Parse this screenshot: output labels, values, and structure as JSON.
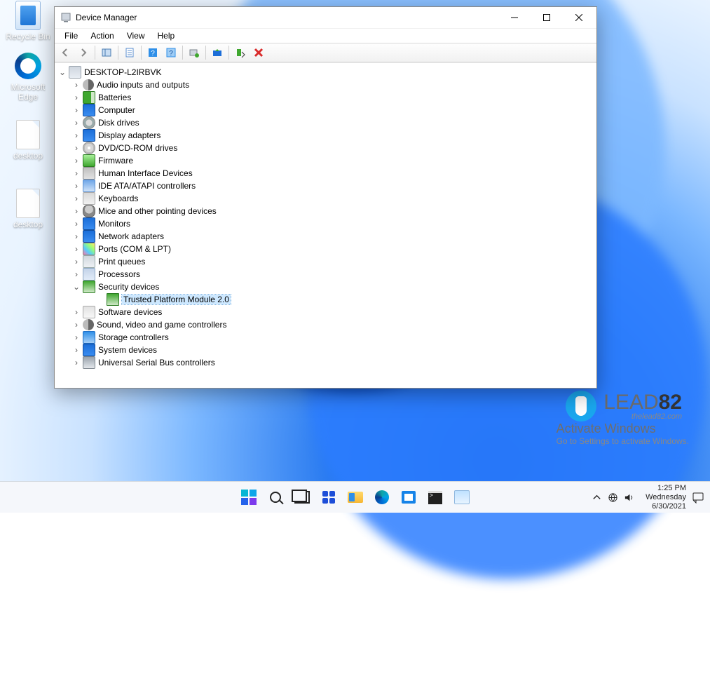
{
  "desktop": {
    "icons": [
      {
        "name": "recycle-bin",
        "label": "Recycle Bin"
      },
      {
        "name": "edge",
        "label": "Microsoft Edge"
      },
      {
        "name": "file1",
        "label": "desktop"
      },
      {
        "name": "file2",
        "label": "desktop"
      }
    ]
  },
  "watermark": {
    "line1": "Activate Windows",
    "line2": "Go to Settings to activate Windows."
  },
  "lead82": {
    "brand_lead": "LEAD",
    "brand_num": "82",
    "site": "thelead82.com"
  },
  "taskbar": {
    "buttons": [
      {
        "name": "start"
      },
      {
        "name": "search"
      },
      {
        "name": "task-view"
      },
      {
        "name": "widgets"
      },
      {
        "name": "file-explorer"
      },
      {
        "name": "edge"
      },
      {
        "name": "store"
      },
      {
        "name": "cmd"
      },
      {
        "name": "devmgmt"
      }
    ],
    "clock": {
      "time": "1:25 PM",
      "day": "Wednesday",
      "date": "6/30/2021"
    }
  },
  "devmgr": {
    "title": "Device Manager",
    "menu": [
      "File",
      "Action",
      "View",
      "Help"
    ],
    "toolbar": [
      {
        "name": "back-icon"
      },
      {
        "name": "forward-icon"
      },
      {
        "sep": true
      },
      {
        "name": "show-hidden-icon"
      },
      {
        "sep": true
      },
      {
        "name": "properties-icon"
      },
      {
        "sep": true
      },
      {
        "name": "help-icon"
      },
      {
        "name": "help-topics-icon"
      },
      {
        "sep": true
      },
      {
        "name": "scan-hardware-icon"
      },
      {
        "sep": true
      },
      {
        "name": "update-driver-icon"
      },
      {
        "sep": true
      },
      {
        "name": "uninstall-icon"
      },
      {
        "name": "disable-icon"
      }
    ],
    "root": "DESKTOP-L2IRBVK",
    "categories": [
      {
        "name": "Audio inputs and outputs",
        "icon": "i-aud"
      },
      {
        "name": "Batteries",
        "icon": "i-bat"
      },
      {
        "name": "Computer",
        "icon": "i-mon"
      },
      {
        "name": "Disk drives",
        "icon": "i-dsk"
      },
      {
        "name": "Display adapters",
        "icon": "i-mon"
      },
      {
        "name": "DVD/CD-ROM drives",
        "icon": "i-cd"
      },
      {
        "name": "Firmware",
        "icon": "i-fw"
      },
      {
        "name": "Human Interface Devices",
        "icon": "i-hid"
      },
      {
        "name": "IDE ATA/ATAPI controllers",
        "icon": "i-ide"
      },
      {
        "name": "Keyboards",
        "icon": "i-key"
      },
      {
        "name": "Mice and other pointing devices",
        "icon": "i-mse"
      },
      {
        "name": "Monitors",
        "icon": "i-mon"
      },
      {
        "name": "Network adapters",
        "icon": "i-net"
      },
      {
        "name": "Ports (COM & LPT)",
        "icon": "i-prt"
      },
      {
        "name": "Print queues",
        "icon": "i-prn"
      },
      {
        "name": "Processors",
        "icon": "i-cpu"
      },
      {
        "name": "Security devices",
        "icon": "i-sec",
        "expanded": true,
        "children": [
          {
            "name": "Trusted Platform Module 2.0",
            "icon": "i-tpm",
            "selected": true
          }
        ]
      },
      {
        "name": "Software devices",
        "icon": "i-sw"
      },
      {
        "name": "Sound, video and game controllers",
        "icon": "i-snd"
      },
      {
        "name": "Storage controllers",
        "icon": "i-stc"
      },
      {
        "name": "System devices",
        "icon": "i-sys"
      },
      {
        "name": "Universal Serial Bus controllers",
        "icon": "i-usb"
      }
    ]
  }
}
